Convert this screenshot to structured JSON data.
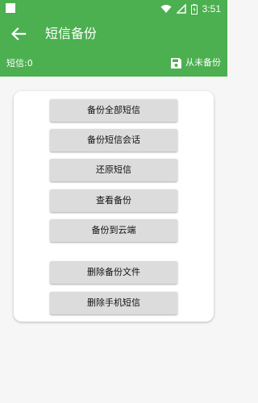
{
  "status_bar": {
    "time": "3:51"
  },
  "toolbar": {
    "title": "短信备份"
  },
  "subbar": {
    "count_label": "短信:0",
    "last_backup": "从未备份"
  },
  "buttons": [
    "备份全部短信",
    "备份短信会话",
    "还原短信",
    "查看备份",
    "备份到云端",
    "删除备份文件",
    "删除手机短信"
  ],
  "colors": {
    "primary": "#4caf50",
    "button_bg": "#dcdcdc",
    "page_bg": "#f6f6f6"
  }
}
